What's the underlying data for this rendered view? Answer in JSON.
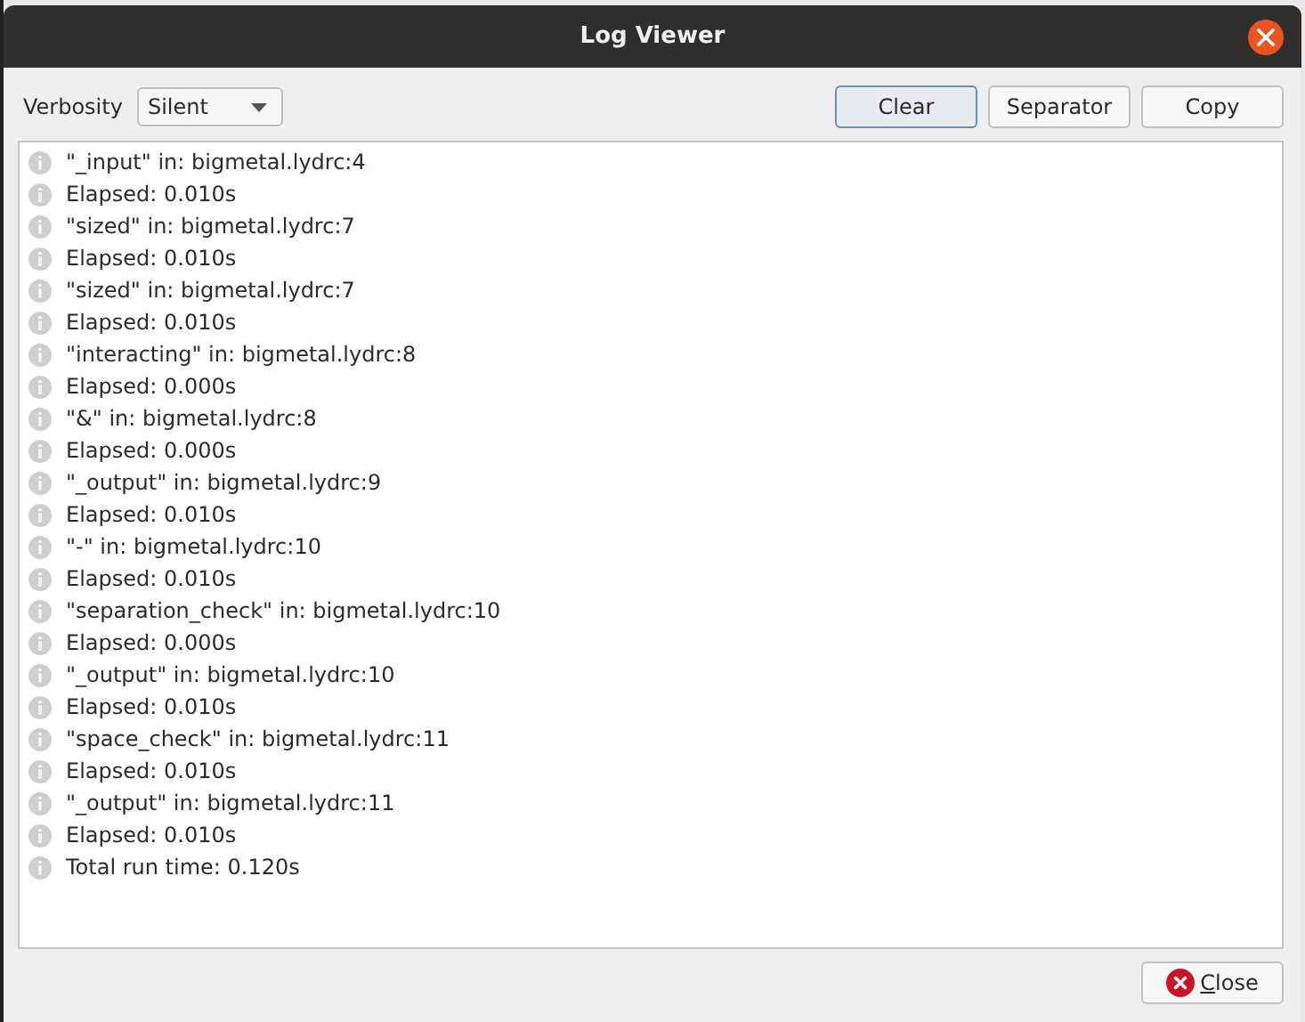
{
  "window": {
    "title": "Log Viewer"
  },
  "toolbar": {
    "verbosity_label": "Verbosity",
    "verbosity": {
      "value": "Silent"
    },
    "buttons": [
      {
        "label": "Clear",
        "focused": true
      },
      {
        "label": "Separator",
        "focused": false
      },
      {
        "label": "Copy",
        "focused": false
      }
    ]
  },
  "log": [
    {
      "kind": "info",
      "text": "\"_input\" in: bigmetal.lydrc:4"
    },
    {
      "kind": "info",
      "text": "Elapsed: 0.010s"
    },
    {
      "kind": "info",
      "text": "\"sized\" in: bigmetal.lydrc:7"
    },
    {
      "kind": "info",
      "text": "Elapsed: 0.010s"
    },
    {
      "kind": "info",
      "text": "\"sized\" in: bigmetal.lydrc:7"
    },
    {
      "kind": "info",
      "text": "Elapsed: 0.010s"
    },
    {
      "kind": "info",
      "text": "\"interacting\" in: bigmetal.lydrc:8"
    },
    {
      "kind": "info",
      "text": "Elapsed: 0.000s"
    },
    {
      "kind": "info",
      "text": "\"&\" in: bigmetal.lydrc:8"
    },
    {
      "kind": "info",
      "text": "Elapsed: 0.000s"
    },
    {
      "kind": "info",
      "text": "\"_output\" in: bigmetal.lydrc:9"
    },
    {
      "kind": "info",
      "text": "Elapsed: 0.010s"
    },
    {
      "kind": "info",
      "text": "\"-\" in: bigmetal.lydrc:10"
    },
    {
      "kind": "info",
      "text": "Elapsed: 0.010s"
    },
    {
      "kind": "info",
      "text": "\"separation_check\" in: bigmetal.lydrc:10"
    },
    {
      "kind": "info",
      "text": "Elapsed: 0.000s"
    },
    {
      "kind": "info",
      "text": "\"_output\" in: bigmetal.lydrc:10"
    },
    {
      "kind": "info",
      "text": "Elapsed: 0.010s"
    },
    {
      "kind": "info",
      "text": "\"space_check\" in: bigmetal.lydrc:11"
    },
    {
      "kind": "info",
      "text": "Elapsed: 0.010s"
    },
    {
      "kind": "info",
      "text": "\"_output\" in: bigmetal.lydrc:11"
    },
    {
      "kind": "info",
      "text": "Elapsed: 0.010s"
    },
    {
      "kind": "info",
      "text": "Total run time: 0.120s"
    }
  ],
  "footer": {
    "close_button": "Close"
  }
}
